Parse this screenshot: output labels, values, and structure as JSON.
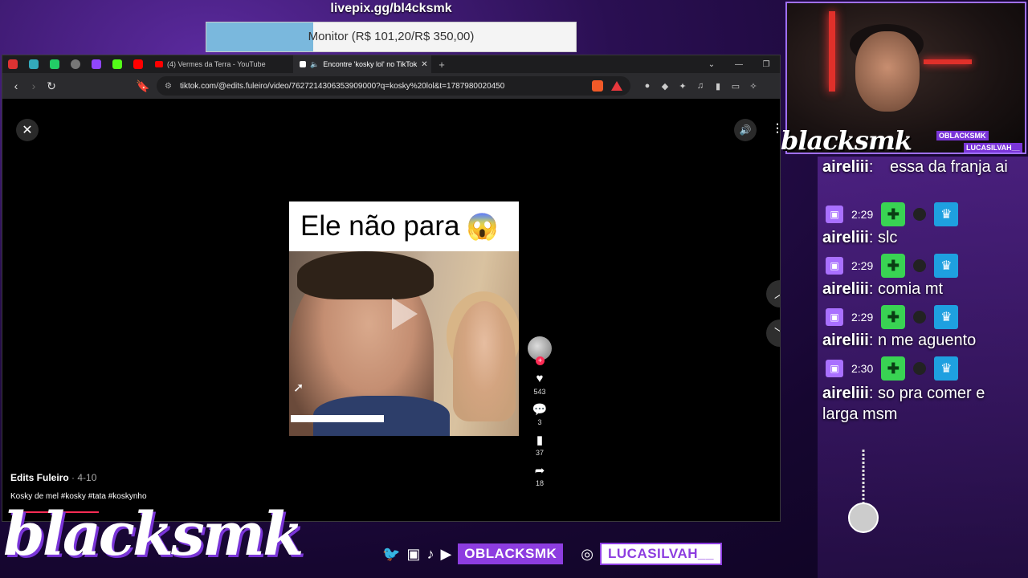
{
  "overlay": {
    "donation_url": "livepix.gg/bl4cksmk",
    "goal_label": "Monitor (R$ 101,20/R$ 350,00)",
    "goal_progress": 0.289
  },
  "browser": {
    "tabs": [
      {
        "label": "(4) Vermes da Terra - YouTube",
        "active": false
      },
      {
        "label": "Encontre 'kosky lol' no TikTok",
        "active": true
      }
    ],
    "new_tab_label": "+",
    "url": "tiktok.com/@edits.fuleiro/video/7627214306353909000?q=kosky%20lol&t=1787980020450"
  },
  "tiktok": {
    "video_caption": "Ele não para",
    "video_emoji": "😱",
    "likes": "543",
    "comments": "3",
    "saves": "37",
    "shares": "18",
    "author": "Edits Fuleiro",
    "date": "4-10",
    "description": "Kosky de mel #kosky #tata #koskynho"
  },
  "chat": {
    "messages": [
      {
        "user": "aireliii",
        "text": "essa da franja ai",
        "time": ""
      },
      {
        "user": "aireliii",
        "text": "slc",
        "time": "2:29"
      },
      {
        "user": "aireliii",
        "text": "comia mt",
        "time": "2:29"
      },
      {
        "user": "aireliii",
        "text": "n me aguento",
        "time": "2:29"
      },
      {
        "user": "aireliii",
        "text": "so pra comer e larga msm",
        "time": "2:30"
      }
    ]
  },
  "webcam": {
    "logo": "blacksmk",
    "handle_1": "OBLACKSMK",
    "handle_2": "LUCASILVAH__"
  },
  "footer": {
    "logo": "blacksmk",
    "handle_1": "OBLACKSMK",
    "handle_2": "LUCASILVAH__"
  }
}
